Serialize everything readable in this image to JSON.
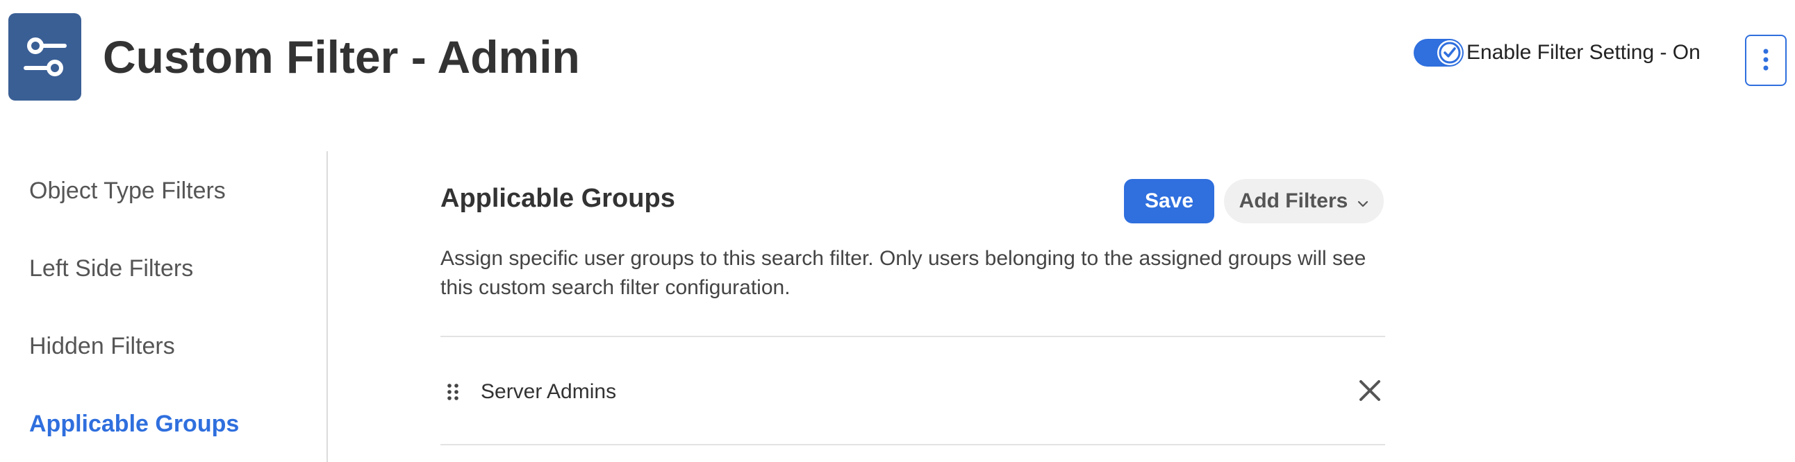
{
  "header": {
    "title": "Custom Filter - Admin",
    "app_icon": "sliders-icon",
    "toggle": {
      "label": "Enable Filter Setting - On",
      "checked": true
    },
    "more_icon": "vertical-dots-icon"
  },
  "sidebar": {
    "items": [
      {
        "label": "Object Type Filters",
        "active": false
      },
      {
        "label": "Left Side Filters",
        "active": false
      },
      {
        "label": "Hidden Filters",
        "active": false
      },
      {
        "label": "Applicable Groups",
        "active": true
      }
    ]
  },
  "main": {
    "section_title": "Applicable Groups",
    "save_label": "Save",
    "add_filters_label": "Add Filters",
    "description": "Assign specific user groups to this search filter. Only users belonging to the assigned groups will see this custom search filter configuration.",
    "groups": [
      {
        "name": "Server Admins"
      }
    ]
  },
  "colors": {
    "accent": "#2f6fde",
    "app_icon_bg": "#3a5f95",
    "text": "#333333"
  }
}
